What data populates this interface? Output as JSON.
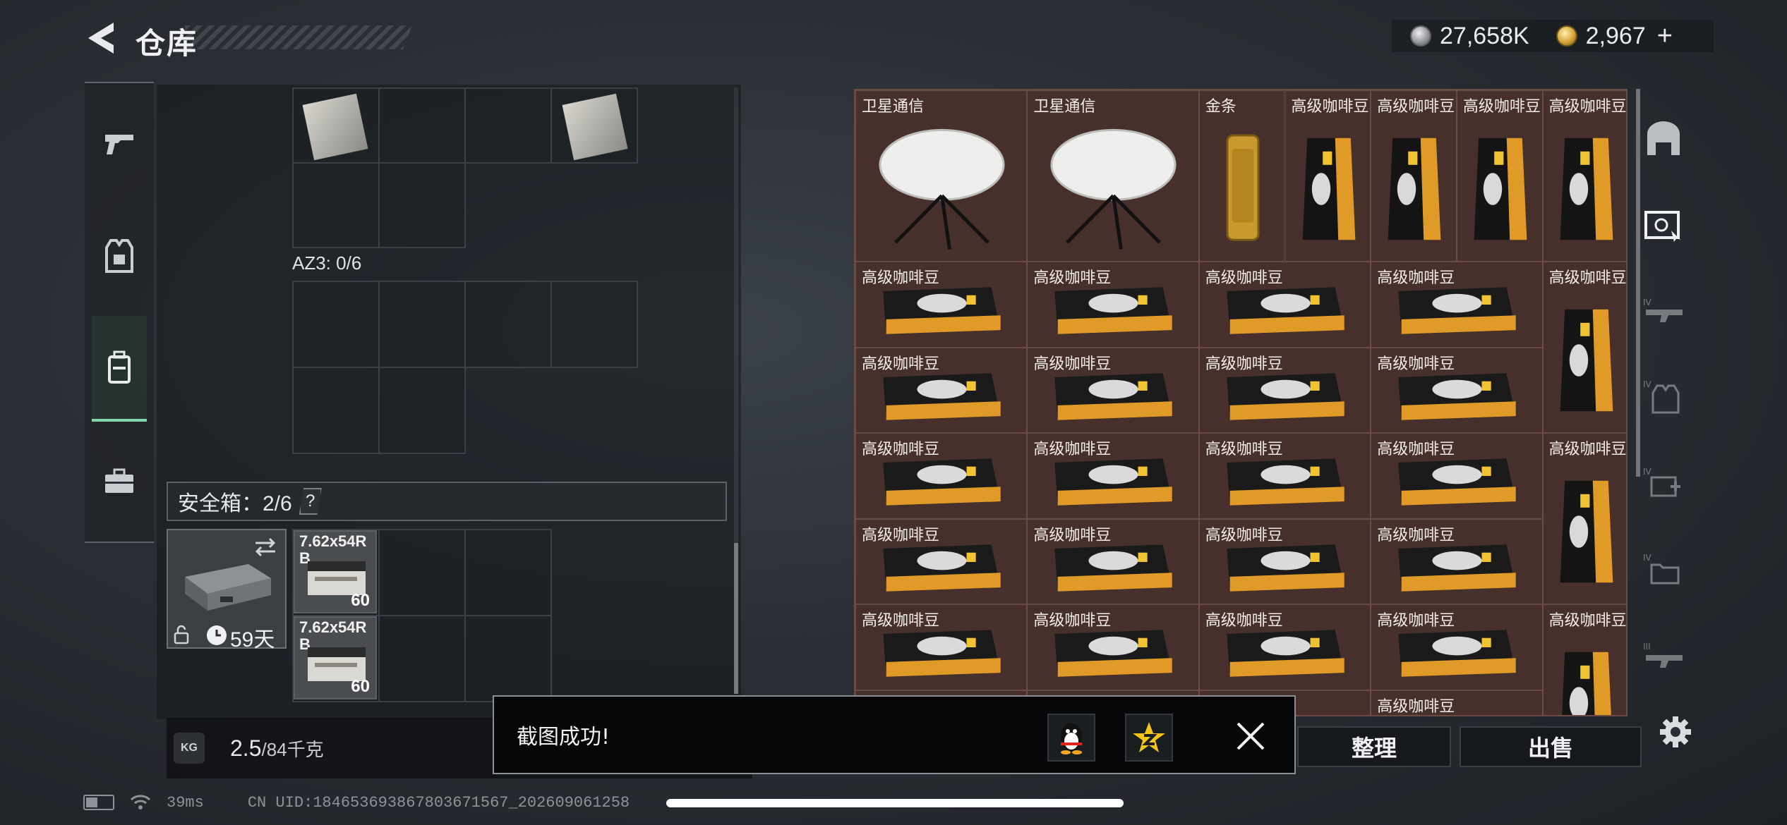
{
  "header": {
    "title": "仓库",
    "currency_silver": "27,658K",
    "currency_gold": "2,967",
    "currency_plus": "+"
  },
  "left_panel": {
    "container_label": "AZ3: 0/6",
    "safe_box_label": "安全箱：2/6",
    "safe_box_help": "?",
    "safe_box_timer": "59天",
    "ammo_items": [
      {
        "name": "7.62x54R",
        "sub": "B",
        "count": "60"
      },
      {
        "name": "7.62x54R",
        "sub": "B",
        "count": "60"
      }
    ],
    "weight_value": "2.5",
    "weight_max": "/84千克",
    "kg_icon": "KG"
  },
  "storage": {
    "row1": [
      {
        "name": "卫星通信",
        "art": "satellite-dish"
      },
      {
        "name": "卫星通信",
        "art": "satellite-dish"
      },
      {
        "name": "金条",
        "art": "gold-bar"
      },
      {
        "name": "高级咖啡豆",
        "art": "coffee-bag"
      },
      {
        "name": "高级咖啡豆",
        "art": "coffee-bag"
      },
      {
        "name": "高级咖啡豆",
        "art": "coffee-bag"
      },
      {
        "name": "高级咖啡豆",
        "art": "coffee-bag"
      }
    ],
    "horizontal_item_name": "高级咖啡豆",
    "vertical_item_name": "高级咖啡豆"
  },
  "actions": {
    "sort_label": "整理",
    "sell_label": "出售"
  },
  "toast": {
    "message": "截图成功!"
  },
  "status_bar": {
    "ping": "39ms",
    "uid": "CN UID:1846536938678036715​67_202609061258"
  },
  "colors": {
    "accent_active": "#7fd6a8",
    "storage_bg": "#3d2a27",
    "toast_bg": "#060708"
  }
}
